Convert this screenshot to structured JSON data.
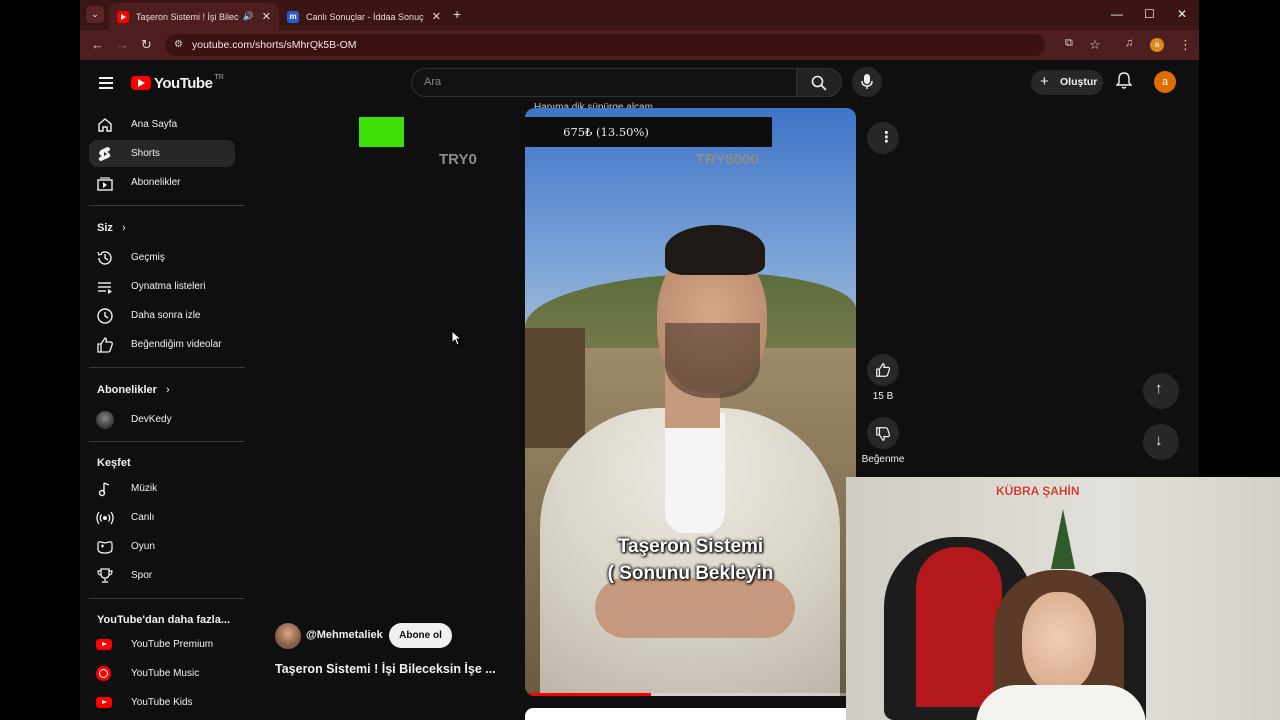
{
  "browser": {
    "tabs": [
      {
        "title": "Taşeron Sistemi ! İşi Bileceksin İşe",
        "active": true
      },
      {
        "title": "Canlı Sonuçlar - İddaa Sonuçları",
        "active": false
      }
    ],
    "url": "youtube.com/shorts/sMhrQk5B-OM",
    "profile_initial": "a"
  },
  "youtube": {
    "logo_text": "YouTube",
    "country_code": "TR",
    "search_placeholder": "Ara",
    "create_label": "Oluştur",
    "avatar_initial": "a"
  },
  "sidebar": {
    "main": [
      {
        "label": "Ana Sayfa",
        "icon": "home-icon"
      },
      {
        "label": "Shorts",
        "icon": "shorts-icon",
        "active": true
      },
      {
        "label": "Abonelikler",
        "icon": "subscriptions-icon"
      }
    ],
    "you_heading": "Siz",
    "you": [
      {
        "label": "Geçmiş",
        "icon": "history-icon"
      },
      {
        "label": "Oynatma listeleri",
        "icon": "playlist-icon"
      },
      {
        "label": "Daha sonra izle",
        "icon": "clock-icon"
      },
      {
        "label": "Beğendiğim videolar",
        "icon": "like-icon"
      }
    ],
    "subs_heading": "Abonelikler",
    "subs": [
      {
        "label": "DevKedy",
        "icon": "channel-avatar"
      }
    ],
    "explore_heading": "Keşfet",
    "explore": [
      {
        "label": "Müzik",
        "icon": "music-icon"
      },
      {
        "label": "Canlı",
        "icon": "live-icon"
      },
      {
        "label": "Oyun",
        "icon": "gaming-icon"
      },
      {
        "label": "Spor",
        "icon": "trophy-icon"
      }
    ],
    "more_heading": "YouTube'dan daha fazla...",
    "more": [
      {
        "label": "YouTube Premium",
        "icon": "yt-premium-icon"
      },
      {
        "label": "YouTube Music",
        "icon": "yt-music-icon"
      },
      {
        "label": "YouTube Kids",
        "icon": "yt-kids-icon"
      }
    ]
  },
  "short": {
    "header_text": "Hanıma dik süpürge alcam",
    "caption_line1": "Taşeron Sistemi",
    "caption_line2": "( Sonunu Bekleyin",
    "channel": "@Mehmetaliek",
    "subscribe_label": "Abone ol",
    "title": "Taşeron Sistemi ! İşi Bileceksin İşe ...",
    "likes": "15 B",
    "dislike_label": "Beğenme",
    "progress": 0.38
  },
  "overlay": {
    "progress_text": "675₺ (13.50%)",
    "progress_fraction": 0.135,
    "min_label": "TRY0",
    "max_label": "TRY5000",
    "streamer_name": "KÜBRA ŞAHİN"
  },
  "colors": {
    "tab_bar": "#3b1414",
    "toolbar": "#4e1d1d",
    "yt_red": "#ff0000",
    "goal_green": "#3fe00a",
    "avatar": "#e06c00"
  }
}
